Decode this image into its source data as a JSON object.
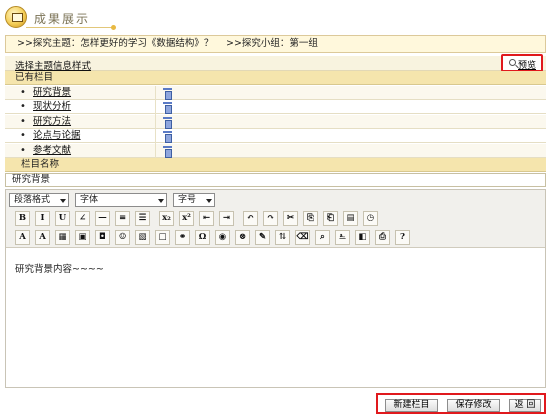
{
  "header": {
    "title": "成果展示"
  },
  "breadcrumb": {
    "topic": ">>探究主题：怎样更好的学习《数据结构》？",
    "group": ">>探究小组：第一组"
  },
  "style_row": {
    "link": "选择主题信息样式",
    "preview": "预览"
  },
  "existing": {
    "heading": "已有栏目",
    "items": [
      {
        "label": "研究背景"
      },
      {
        "label": "现状分析"
      },
      {
        "label": "研究方法"
      },
      {
        "label": "论点与论据"
      },
      {
        "label": "参考文献"
      }
    ]
  },
  "column_name": {
    "heading": "栏目名称",
    "value": "研究背景"
  },
  "editor": {
    "format_select": "段落格式",
    "font_select": "字体",
    "size_select": "字号",
    "row1_buttons": [
      {
        "icon": "bold-icon",
        "text": "B"
      },
      {
        "icon": "italic-icon",
        "text": "I"
      },
      {
        "icon": "underline-icon",
        "text": "U"
      },
      {
        "icon": "eraser-icon",
        "text": "∠"
      },
      {
        "icon": "horizontal-rule-icon",
        "text": "—"
      },
      {
        "icon": "align-icon",
        "text": "≡"
      },
      {
        "icon": "numbered-list-icon",
        "text": "☰"
      },
      {
        "icon": "subscript-icon",
        "text": "x₂"
      },
      {
        "icon": "superscript-icon",
        "text": "x²"
      },
      {
        "icon": "outdent-icon",
        "text": "⇤"
      },
      {
        "icon": "indent-icon",
        "text": "⇥"
      },
      {
        "icon": "undo-icon",
        "text": "↶"
      },
      {
        "icon": "redo-icon",
        "text": "↷"
      },
      {
        "icon": "cut-icon",
        "text": "✂"
      },
      {
        "icon": "copy-icon",
        "text": "⎘"
      },
      {
        "icon": "paste-icon",
        "text": "⎗"
      },
      {
        "icon": "paste-text-icon",
        "text": "▤"
      },
      {
        "icon": "clock-icon",
        "text": "◷"
      }
    ],
    "row2_buttons": [
      {
        "icon": "font-color-icon",
        "text": "A"
      },
      {
        "icon": "highlight-icon",
        "text": "A"
      },
      {
        "icon": "table-icon",
        "text": "▦"
      },
      {
        "icon": "image-icon",
        "text": "▣"
      },
      {
        "icon": "flash-icon",
        "text": "◘"
      },
      {
        "icon": "smiley-icon",
        "text": "☺"
      },
      {
        "icon": "media-icon",
        "text": "▧"
      },
      {
        "icon": "frame-icon",
        "text": "□"
      },
      {
        "icon": "link-icon",
        "text": "⚭"
      },
      {
        "icon": "omega-icon",
        "text": "Ω"
      },
      {
        "icon": "special-char-icon",
        "text": "◉"
      },
      {
        "icon": "unlink-icon",
        "text": "⊗"
      },
      {
        "icon": "edit-icon",
        "text": "✎"
      },
      {
        "icon": "sort-icon",
        "text": "⇅"
      },
      {
        "icon": "delete-icon",
        "text": "⌫"
      },
      {
        "icon": "search-icon",
        "text": "⌕"
      },
      {
        "icon": "replace-icon",
        "text": "⎁"
      },
      {
        "icon": "preview-icon",
        "text": "◧"
      },
      {
        "icon": "print-icon",
        "text": "⎙"
      },
      {
        "icon": "help-icon",
        "text": "?"
      }
    ],
    "content": "研究背景内容~~~~"
  },
  "actions": {
    "new": "新建栏目",
    "save": "保存修改",
    "back": "返 回"
  },
  "colors": {
    "accent": "#f5e5ad",
    "highlight_border": "#e0191d",
    "icon_blue": "#3e5fa3"
  }
}
